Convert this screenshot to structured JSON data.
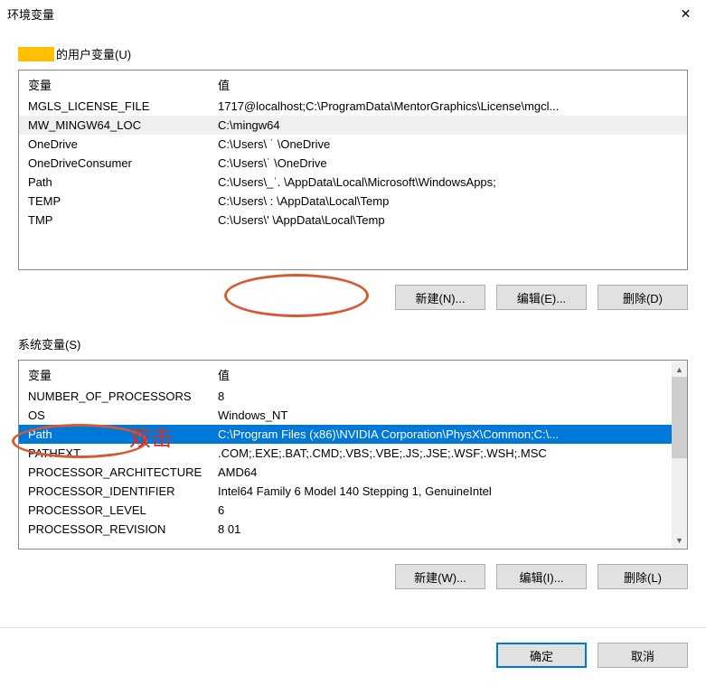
{
  "window": {
    "title": "环境变量",
    "close_glyph": "✕"
  },
  "userSection": {
    "labelSuffix": "的用户变量(U)",
    "header": {
      "name": "变量",
      "value": "值"
    },
    "rows": [
      {
        "name": "MGLS_LICENSE_FILE",
        "value": "1717@localhost;C:\\ProgramData\\MentorGraphics\\License\\mgcl..."
      },
      {
        "name": "MW_MINGW64_LOC",
        "value": "C:\\mingw64"
      },
      {
        "name": "OneDrive",
        "value": "C:\\Users\\ ˙    \\OneDrive"
      },
      {
        "name": "OneDriveConsumer",
        "value": "C:\\Users\\˙      \\OneDrive"
      },
      {
        "name": "Path",
        "value": "C:\\Users\\_ˈ.   \\AppData\\Local\\Microsoft\\WindowsApps;"
      },
      {
        "name": "TEMP",
        "value": "C:\\Users\\ :     \\AppData\\Local\\Temp"
      },
      {
        "name": "TMP",
        "value": "C:\\Users\\'      \\AppData\\Local\\Temp"
      }
    ],
    "buttons": {
      "new": "新建(N)...",
      "edit": "编辑(E)...",
      "delete": "删除(D)"
    }
  },
  "systemSection": {
    "label": "系统变量(S)",
    "header": {
      "name": "变量",
      "value": "值"
    },
    "rows": [
      {
        "name": "NUMBER_OF_PROCESSORS",
        "value": "8"
      },
      {
        "name": "OS",
        "value": "Windows_NT"
      },
      {
        "name": "Path",
        "value": "C:\\Program Files (x86)\\NVIDIA Corporation\\PhysX\\Common;C:\\...",
        "selected": true
      },
      {
        "name": "PATHEXT",
        "value": ".COM;.EXE;.BAT;.CMD;.VBS;.VBE;.JS;.JSE;.WSF;.WSH;.MSC"
      },
      {
        "name": "PROCESSOR_ARCHITECTURE",
        "value": "AMD64"
      },
      {
        "name": "PROCESSOR_IDENTIFIER",
        "value": "Intel64 Family 6 Model 140 Stepping 1, GenuineIntel"
      },
      {
        "name": "PROCESSOR_LEVEL",
        "value": "6"
      },
      {
        "name": "PROCESSOR_REVISION",
        "value": "8 01"
      }
    ],
    "buttons": {
      "new": "新建(W)...",
      "edit": "编辑(I)...",
      "delete": "删除(L)"
    }
  },
  "dialogButtons": {
    "ok": "确定",
    "cancel": "取消"
  },
  "annotations": {
    "doubleClick": "双击"
  },
  "scroll": {
    "up": "▲",
    "down": "▼"
  }
}
